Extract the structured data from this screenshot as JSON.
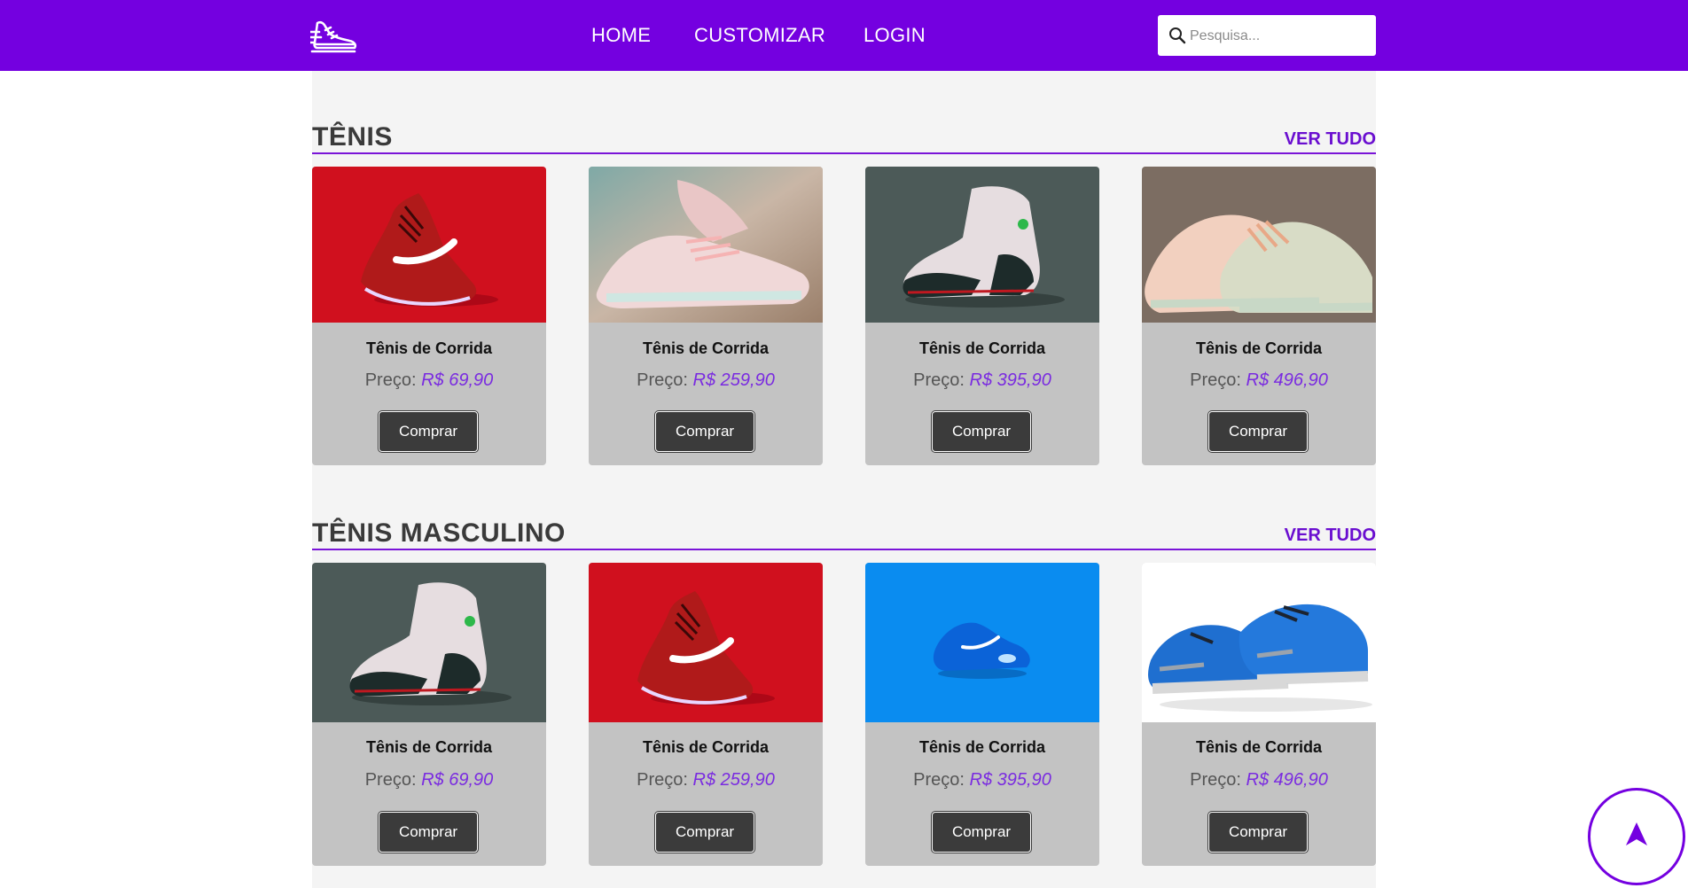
{
  "header": {
    "logo_icon": "running-shoe-icon",
    "nav": [
      "HOME",
      "CUSTOMIZAR",
      "LOGIN"
    ],
    "search": {
      "placeholder": "Pesquisa...",
      "value": "",
      "icon": "search-icon"
    },
    "background": "#7400e0"
  },
  "colors": {
    "accent": "#7400e0",
    "price": "#7a2be0",
    "card_bg": "#c3c3c3",
    "button_bg": "#3b3b3b"
  },
  "sections": [
    {
      "title": "TÊNIS",
      "see_all": "VER TUDO",
      "products": [
        {
          "image": "red-running-shoe",
          "name": "Tênis de Corrida",
          "price_label": "Preço:",
          "price": "R$ 69,90",
          "button": "Comprar"
        },
        {
          "image": "pastel-pink-sneakers",
          "name": "Tênis de Corrida",
          "price_label": "Preço:",
          "price": "R$ 259,90",
          "button": "Comprar"
        },
        {
          "image": "white-black-high-top",
          "name": "Tênis de Corrida",
          "price_label": "Preço:",
          "price": "R$ 395,90",
          "button": "Comprar"
        },
        {
          "image": "pastel-knit-sneakers",
          "name": "Tênis de Corrida",
          "price_label": "Preço:",
          "price": "R$ 496,90",
          "button": "Comprar"
        }
      ]
    },
    {
      "title": "TÊNIS MASCULINO",
      "see_all": "VER TUDO",
      "products": [
        {
          "image": "white-black-high-top",
          "name": "Tênis de Corrida",
          "price_label": "Preço:",
          "price": "R$ 69,90",
          "button": "Comprar"
        },
        {
          "image": "red-running-shoe",
          "name": "Tênis de Corrida",
          "price_label": "Preço:",
          "price": "R$ 259,90",
          "button": "Comprar"
        },
        {
          "image": "blue-air-sneaker",
          "name": "Tênis de Corrida",
          "price_label": "Preço:",
          "price": "R$ 395,90",
          "button": "Comprar"
        },
        {
          "image": "blue-running-pair",
          "name": "Tênis de Corrida",
          "price_label": "Preço:",
          "price": "R$ 496,90",
          "button": "Comprar"
        }
      ]
    }
  ],
  "back_to_top_icon": "arrow-up-icon"
}
